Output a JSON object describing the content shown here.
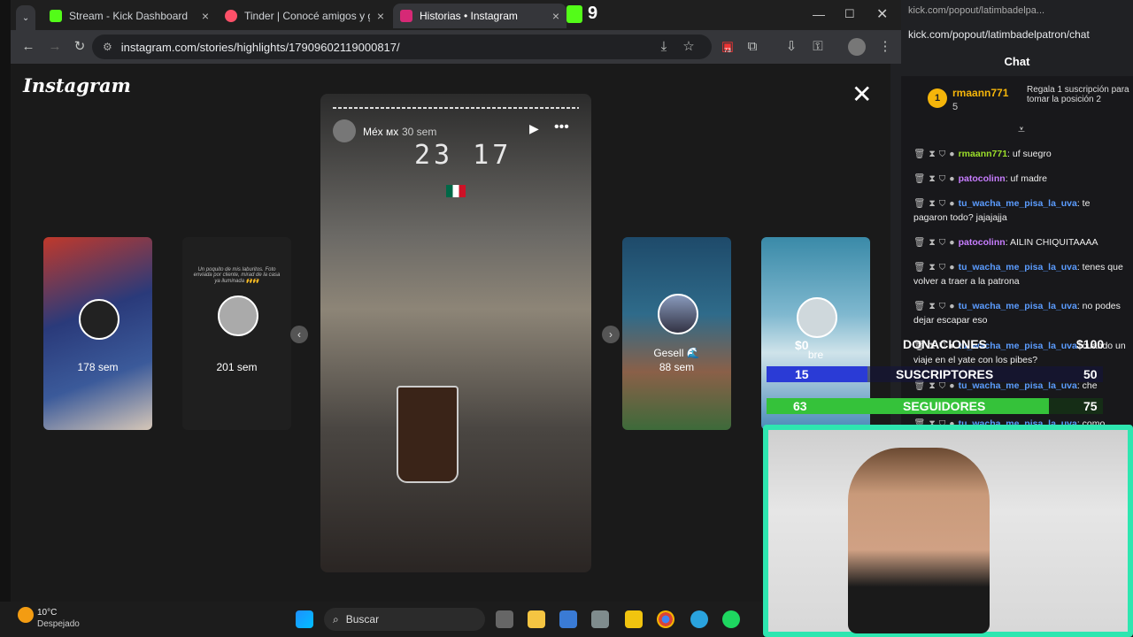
{
  "tabs": [
    {
      "label": "Stream - Kick Dashboard",
      "color": "#53fc18"
    },
    {
      "label": "Tinder | Conocé amigos y gente",
      "color": "#fd5068"
    },
    {
      "label": "Historias • Instagram",
      "color": "#d62976"
    }
  ],
  "kick_badge": "9",
  "url": "instagram.com/stories/highlights/17909602119000817/",
  "extension_badge": "73",
  "instagram": {
    "logo": "Instagram",
    "story_user": "Méx мх",
    "story_time": "30 sem",
    "story_clock": "23 17",
    "left_stories": [
      {
        "age": "178 sem"
      },
      {
        "age": "201 sem",
        "caption": "Un poquito de mis laburitos. Foto enviada por cliente, mirad de la casa ya iluminada 🙌🙌"
      }
    ],
    "right_stories": [
      {
        "name": "Gesell 🌊",
        "age": "88 sem"
      },
      {
        "name": "bre",
        "age": ""
      }
    ]
  },
  "chat": {
    "url": "kick.com/popout/latimbadelpatron/chat",
    "url_short": "kick.com/popout/latimbadelpa...",
    "title": "Chat",
    "top_user": "rmaann771",
    "top_rank": "1",
    "top_count": "5",
    "gift_text": "Regala 1 suscripción para tomar la posición 2",
    "messages": [
      {
        "user": "rmaann771",
        "color": "#9cdf2a",
        "text": ": uf suegro"
      },
      {
        "user": "patocolinn",
        "color": "#c77dff",
        "text": ": uf madre"
      },
      {
        "user": "tu_wacha_me_pisa_la_uva",
        "color": "#5b9cff",
        "text": ": te pagaron todo? jajajajja"
      },
      {
        "user": "patocolinn",
        "color": "#c77dff",
        "text": ": AILIN CHIQUITAAAA"
      },
      {
        "user": "tu_wacha_me_pisa_la_uva",
        "color": "#5b9cff",
        "text": ": tenes que volver a traer a la patrona"
      },
      {
        "user": "tu_wacha_me_pisa_la_uva",
        "color": "#5b9cff",
        "text": ": no podes dejar escapar eso"
      },
      {
        "user": "tu_wacha_me_pisa_la_uva",
        "color": "#5b9cff",
        "text": ": cuando un viaje en el yate con los pibes?"
      },
      {
        "user": "tu_wacha_me_pisa_la_uva",
        "color": "#5b9cff",
        "text": ": che"
      },
      {
        "user": "tu_wacha_me_pisa_la_uva",
        "color": "#5b9cff",
        "text": ": como"
      }
    ]
  },
  "overlay": {
    "donaciones_label": "DONACIONES",
    "donaciones_current": "$0",
    "donaciones_goal": "$100",
    "suscriptores_label": "SUSCRIPTORES",
    "suscriptores_current": "15",
    "suscriptores_goal": "50",
    "suscriptores_progress": 0.3,
    "seguidores_label": "SEGUIDORES",
    "seguidores_current": "63",
    "seguidores_goal": "75",
    "seguidores_progress": 0.84
  },
  "taskbar": {
    "temp": "10°C",
    "weather": "Despejado",
    "search_placeholder": "Buscar"
  }
}
